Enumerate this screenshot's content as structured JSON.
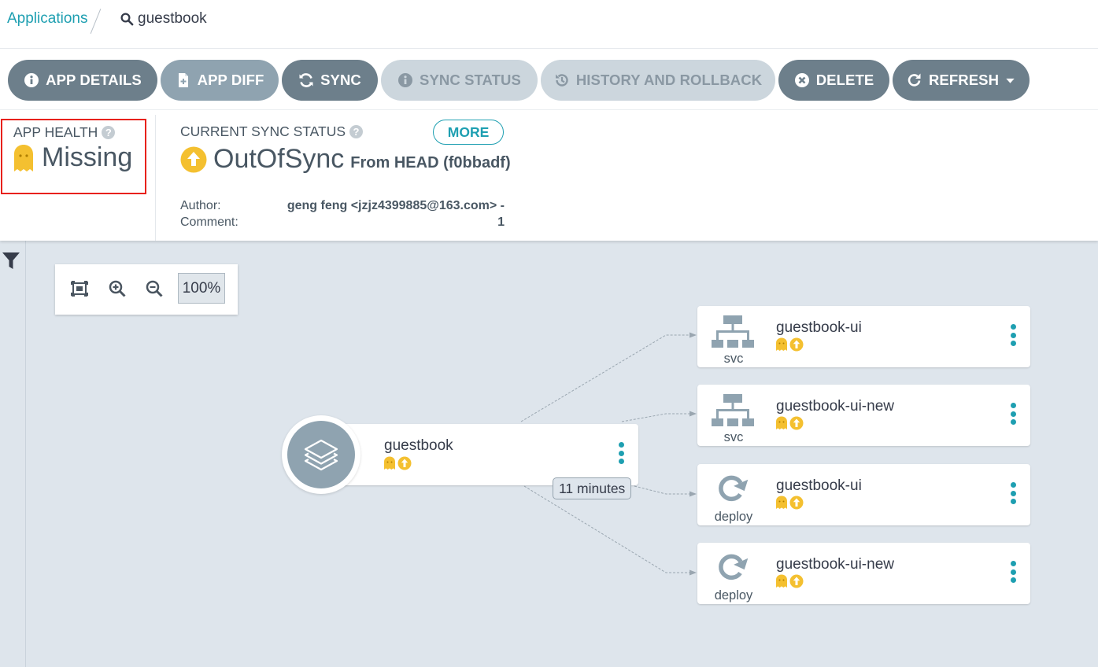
{
  "breadcrumb": {
    "parent": "Applications",
    "current": "guestbook"
  },
  "actions": {
    "app_details": "APP DETAILS",
    "app_diff": "APP DIFF",
    "sync": "SYNC",
    "sync_status": "SYNC STATUS",
    "history": "HISTORY AND ROLLBACK",
    "delete": "DELETE",
    "refresh": "REFRESH"
  },
  "health": {
    "title": "APP HEALTH",
    "value": "Missing"
  },
  "sync": {
    "title": "CURRENT SYNC STATUS",
    "more": "MORE",
    "value": "OutOfSync",
    "from": "From HEAD (f0bbadf)",
    "author_label": "Author:",
    "author_value": "geng feng <jzjz4399885@163.com> -",
    "comment_label": "Comment:",
    "comment_value": "1"
  },
  "zoom": {
    "level": "100%"
  },
  "graph": {
    "app": {
      "name": "guestbook",
      "age": "11 minutes"
    },
    "resources": [
      {
        "name": "guestbook-ui",
        "kind": "svc"
      },
      {
        "name": "guestbook-ui-new",
        "kind": "svc"
      },
      {
        "name": "guestbook-ui",
        "kind": "deploy"
      },
      {
        "name": "guestbook-ui-new",
        "kind": "deploy"
      }
    ]
  },
  "colors": {
    "accent": "#1e9fb1",
    "warning": "#f4c030",
    "highlight": "#e8211b",
    "button": "#6d7f8b"
  }
}
